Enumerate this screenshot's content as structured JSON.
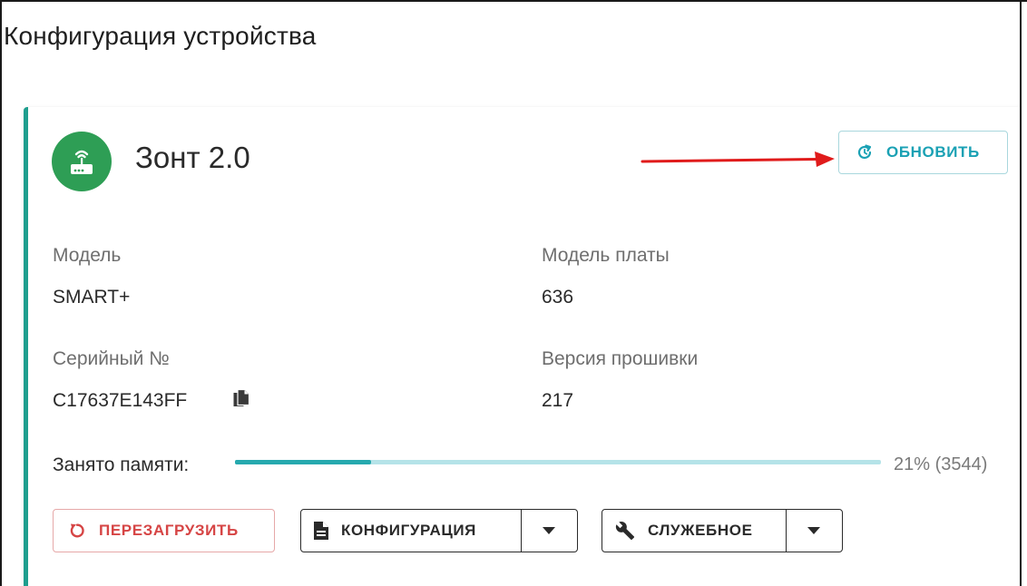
{
  "page": {
    "title": "Конфигурация устройства"
  },
  "device": {
    "name": "Зонт 2.0",
    "avatar_color": "#2e9e55",
    "avatar_icon": "router-icon"
  },
  "actions": {
    "refresh_label": "ОБНОВИТЬ",
    "refresh_icon": "refresh-icon",
    "reboot_label": "ПЕРЕЗАГРУЗИТЬ",
    "reboot_icon": "restart-icon",
    "config_label": "КОНФИГУРАЦИЯ",
    "config_icon": "document-icon",
    "service_label": "СЛУЖЕБНОЕ",
    "service_icon": "wrench-icon",
    "dropdown_icon": "caret-down-icon"
  },
  "info": {
    "model_label": "Модель",
    "model_value": "SMART+",
    "board_label": "Модель платы",
    "board_value": "636",
    "serial_label": "Серийный №",
    "serial_value": "C17637E143FF",
    "firmware_label": "Версия прошивки",
    "firmware_value": "217"
  },
  "memory": {
    "label": "Занято памяти:",
    "percent": 21,
    "value_text": "21%  (3544)"
  },
  "colors": {
    "accent_teal": "#1aa1b4",
    "card_border": "#1e9e8e",
    "danger": "#d64545",
    "annotation_arrow": "#e01b1b"
  }
}
